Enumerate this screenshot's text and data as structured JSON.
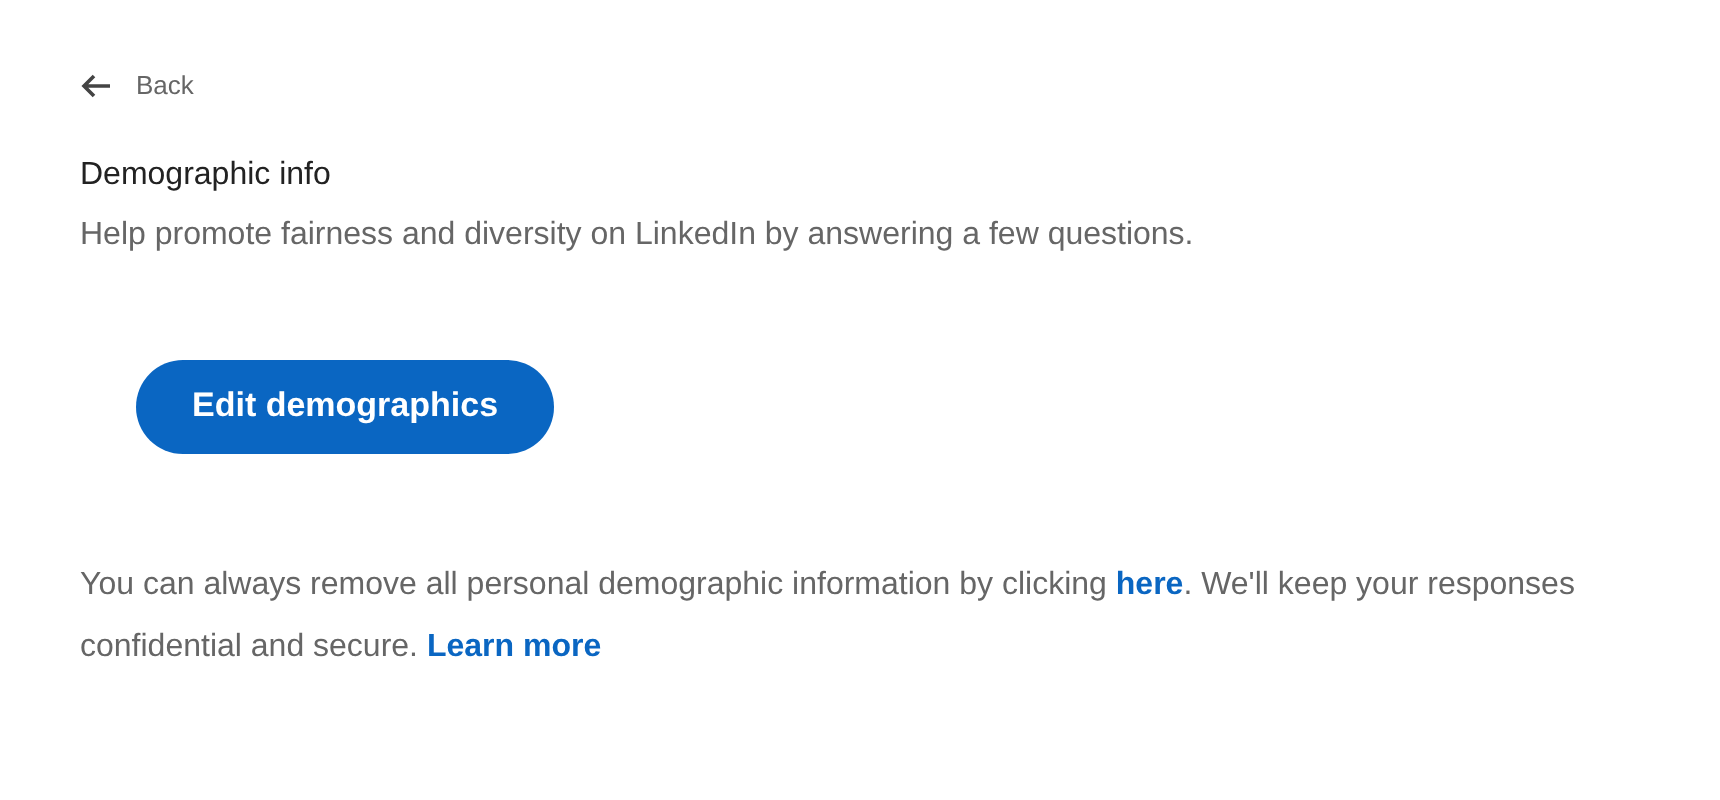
{
  "back_link": {
    "label": "Back"
  },
  "section": {
    "title": "Demographic info",
    "description": "Help promote fairness and diversity on LinkedIn by answering a few questions."
  },
  "primary_button": {
    "label": "Edit demographics"
  },
  "note": [
    {
      "kind": "text",
      "text": "You can always remove all personal demographic information by clicking "
    },
    {
      "kind": "link",
      "text": "here"
    },
    {
      "kind": "text",
      "text": ". We'll keep your responses confidential and secure. "
    },
    {
      "kind": "link",
      "text": "Learn more"
    }
  ]
}
